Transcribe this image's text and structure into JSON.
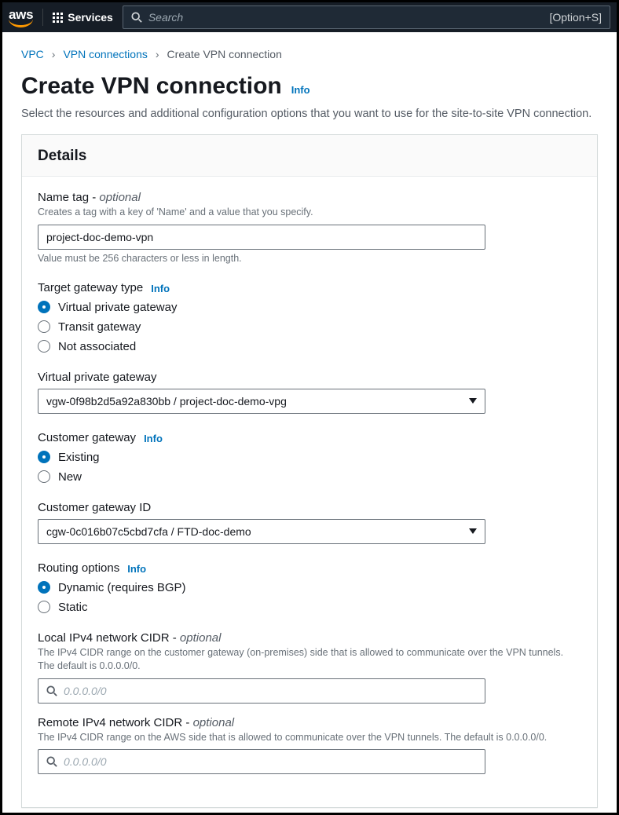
{
  "nav": {
    "logo": "aws",
    "services_label": "Services",
    "search_placeholder": "Search",
    "search_hint": "[Option+S]"
  },
  "crumbs": {
    "vpc": "VPC",
    "vpn_connections": "VPN connections",
    "current": "Create VPN connection"
  },
  "title": "Create VPN connection",
  "info_label": "Info",
  "subtitle": "Select the resources and additional configuration options that you want to use for the site-to-site VPN connection.",
  "panel_title": "Details",
  "name_tag": {
    "label": "Name tag",
    "optional": "optional",
    "desc": "Creates a tag with a key of 'Name' and a value that you specify.",
    "value": "project-doc-demo-vpn",
    "hint": "Value must be 256 characters or less in length."
  },
  "target_gateway": {
    "label": "Target gateway type",
    "options": {
      "vpg": "Virtual private gateway",
      "tgw": "Transit gateway",
      "none": "Not associated"
    }
  },
  "vpg_field": {
    "label": "Virtual private gateway",
    "value": "vgw-0f98b2d5a92a830bb / project-doc-demo-vpg"
  },
  "customer_gateway": {
    "label": "Customer gateway",
    "options": {
      "existing": "Existing",
      "new": "New"
    }
  },
  "cgw_id": {
    "label": "Customer gateway ID",
    "value": "cgw-0c016b07c5cbd7cfa / FTD-doc-demo"
  },
  "routing": {
    "label": "Routing options",
    "options": {
      "dynamic": "Dynamic (requires BGP)",
      "static": "Static"
    }
  },
  "local_cidr": {
    "label": "Local IPv4 network CIDR",
    "optional": "optional",
    "desc": "The IPv4 CIDR range on the customer gateway (on-premises) side that is allowed to communicate over the VPN tunnels. The default is 0.0.0.0/0.",
    "placeholder": "0.0.0.0/0"
  },
  "remote_cidr": {
    "label": "Remote IPv4 network CIDR",
    "optional": "optional",
    "desc": "The IPv4 CIDR range on the AWS side that is allowed to communicate over the VPN tunnels. The default is 0.0.0.0/0.",
    "placeholder": "0.0.0.0/0"
  }
}
